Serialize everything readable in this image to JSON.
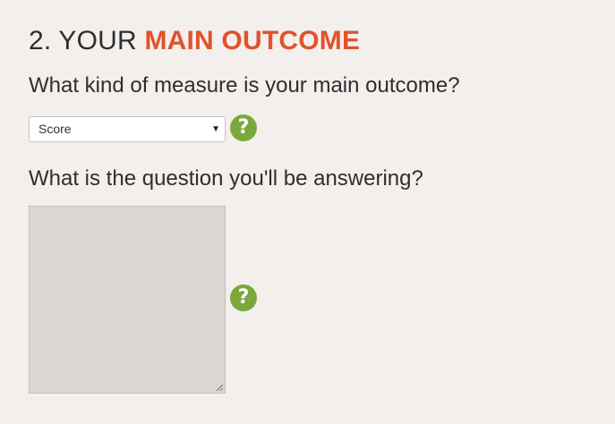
{
  "section": {
    "number_prefix": "2. YOUR ",
    "title_accent": "MAIN OUTCOME"
  },
  "q_measure": {
    "label": "What kind of measure is your main outcome?",
    "selected": "Score",
    "help_glyph": "?"
  },
  "q_question": {
    "label": "What is the question you'll be answering?",
    "value": "",
    "help_glyph": "?"
  },
  "colors": {
    "accent": "#e0532b",
    "help": "#7ba83a",
    "background": "#f3efed"
  }
}
